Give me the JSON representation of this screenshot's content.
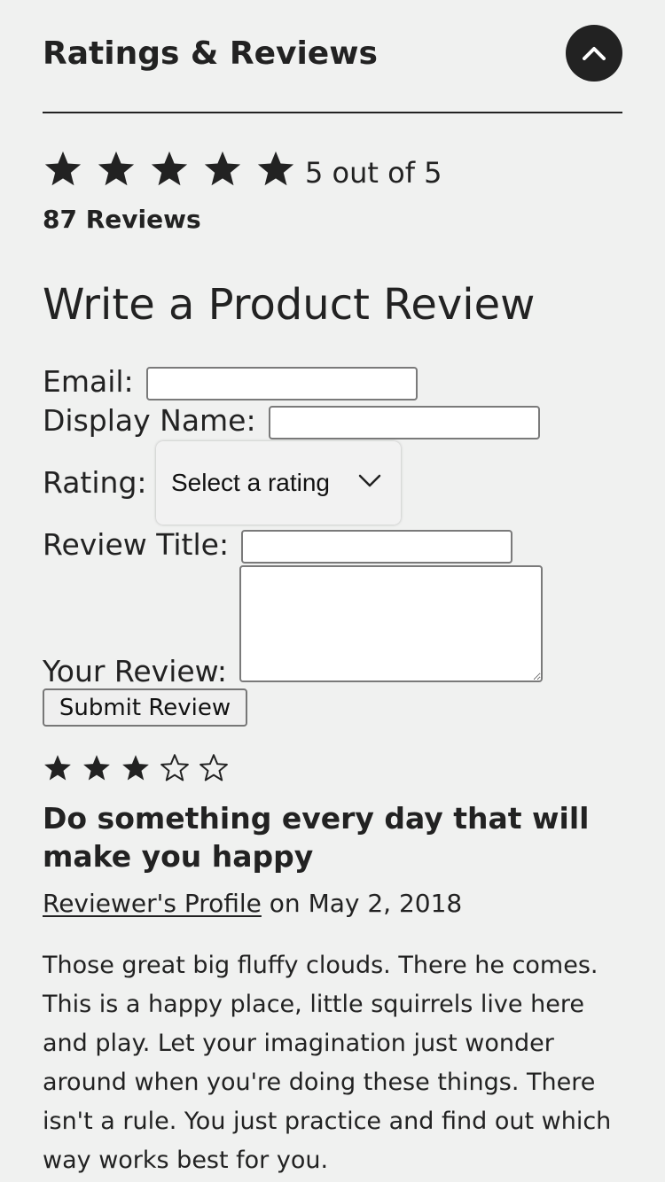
{
  "section": {
    "title": "Ratings & Reviews",
    "collapse_icon": "chevron-up-icon"
  },
  "summary": {
    "rating": 5,
    "max_rating": 5,
    "rating_text": "5 out of 5",
    "review_count_text": "87 Reviews"
  },
  "form": {
    "title": "Write a Product Review",
    "email_label": "Email:",
    "email_value": "",
    "display_name_label": "Display Name:",
    "display_name_value": "",
    "rating_label": "Rating:",
    "rating_select_value": "Select a rating",
    "review_title_label": "Review Title:",
    "review_title_value": "",
    "review_label": "Your Review:",
    "review_value": "",
    "submit_label": "Submit Review"
  },
  "review": {
    "rating": 3,
    "max_rating": 5,
    "title": "Do something every day that will make you happy",
    "profile_link": "Reviewer's Profile",
    "date_text": " on May 2, 2018",
    "body": "Those great big fluffy clouds. There he comes. This is a happy place, little squirrels live here and play. Let your imagination just wonder around when you're doing these things. There isn't a rule. You just practice and find out which way works best for you."
  },
  "colors": {
    "background": "#f0f1f0",
    "text": "#222222",
    "button_dark": "#222222"
  }
}
